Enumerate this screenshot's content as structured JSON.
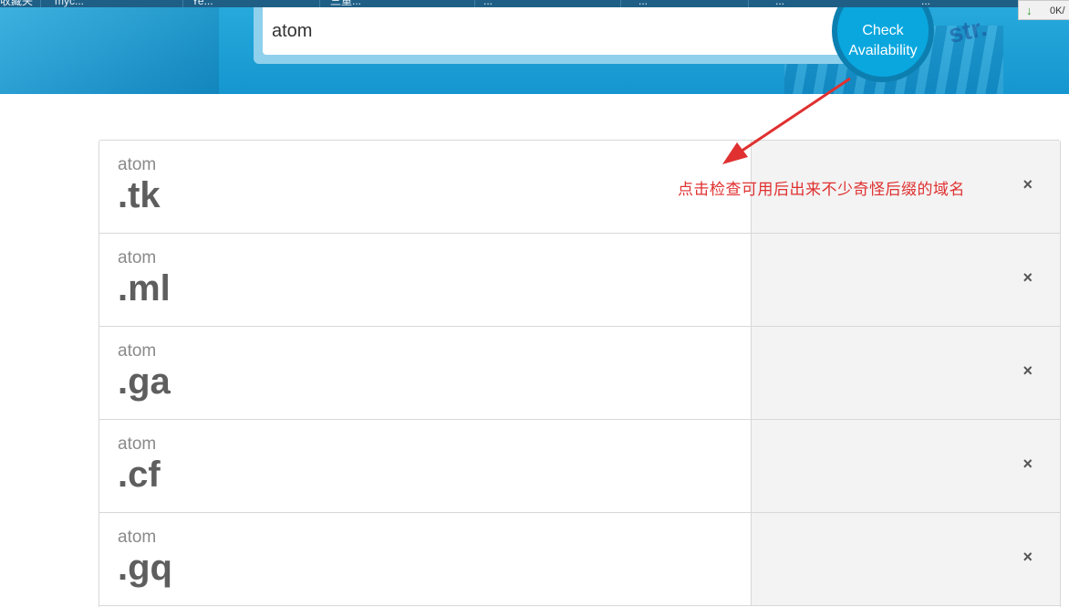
{
  "browser": {
    "bookmarks": [
      "收藏夹",
      "myc...",
      "Ye...",
      "三重...",
      "...",
      "...",
      "...",
      "..."
    ],
    "download_rate": "0K/"
  },
  "search": {
    "query": "atom",
    "button_line1": "Check",
    "button_line2": "Availability"
  },
  "results": [
    {
      "name": "atom",
      "tld": ".tk"
    },
    {
      "name": "atom",
      "tld": ".ml"
    },
    {
      "name": "atom",
      "tld": ".ga"
    },
    {
      "name": "atom",
      "tld": ".cf"
    },
    {
      "name": "atom",
      "tld": ".gq"
    }
  ],
  "remove_icon": "×",
  "annotation": {
    "text": "点击检查可用后出来不少奇怪后缀的域名",
    "color": "#e03030"
  },
  "colors": {
    "banner": "#1596cf",
    "button": "#0aa7df"
  }
}
